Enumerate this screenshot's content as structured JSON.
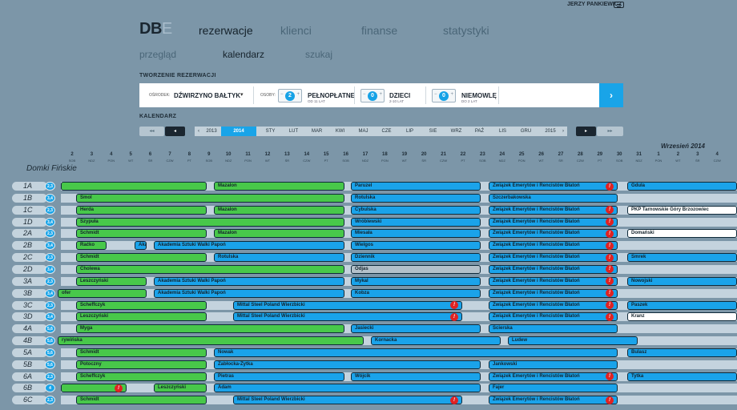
{
  "user": {
    "name": "JERZY PANKIEWICZ"
  },
  "logo": {
    "main": "DB",
    "accent": "E"
  },
  "nav": {
    "main": [
      "rezerwacje",
      "klienci",
      "finanse",
      "statystyki"
    ],
    "sub": [
      "przegląd",
      "kalendarz",
      "szukaj"
    ]
  },
  "sections": {
    "create": "TWORZENIE REZERWACJI",
    "calendar": "KALENDARZ"
  },
  "form": {
    "center_label": "OŚRODEK:",
    "center_value": "DŹWIRZYNO BAŁTYK",
    "persons_label": "OSOBY:",
    "paid": {
      "value": "2",
      "label": "PEŁNOPŁATNE",
      "sub": "OD 11 LAT"
    },
    "kids": {
      "value": "0",
      "label": "DZIECI",
      "sub": "2-10 LAT"
    },
    "infants": {
      "value": "0",
      "label": "NIEMOWLĘ",
      "sub": "DO 2 LAT"
    }
  },
  "timeline": {
    "years": [
      "2013",
      "2014",
      "2015"
    ],
    "months": [
      "STY",
      "LUT",
      "MAR",
      "KWI",
      "MAJ",
      "CZE",
      "LIP",
      "SIE",
      "WRZ",
      "PAŹ",
      "LIS",
      "GRU"
    ],
    "month_title": "Wrzesień  2014"
  },
  "days": [
    [
      "2",
      "SOB"
    ],
    [
      "3",
      "NDZ"
    ],
    [
      "4",
      "PON"
    ],
    [
      "5",
      "WT"
    ],
    [
      "6",
      "ŚR"
    ],
    [
      "7",
      "CZW"
    ],
    [
      "8",
      "PT"
    ],
    [
      "9",
      "SOB"
    ],
    [
      "10",
      "NDZ"
    ],
    [
      "11",
      "PON"
    ],
    [
      "12",
      "WT"
    ],
    [
      "13",
      "ŚR"
    ],
    [
      "14",
      "CZW"
    ],
    [
      "15",
      "PT"
    ],
    [
      "16",
      "SOB"
    ],
    [
      "17",
      "NDZ"
    ],
    [
      "18",
      "PON"
    ],
    [
      "19",
      "WT"
    ],
    [
      "20",
      "ŚR"
    ],
    [
      "21",
      "CZW"
    ],
    [
      "22",
      "PT"
    ],
    [
      "23",
      "SOB"
    ],
    [
      "24",
      "NDZ"
    ],
    [
      "25",
      "PON"
    ],
    [
      "26",
      "WT"
    ],
    [
      "27",
      "ŚR"
    ],
    [
      "28",
      "CZW"
    ],
    [
      "29",
      "PT"
    ],
    [
      "30",
      "SOB"
    ],
    [
      "31",
      "NDZ"
    ],
    [
      "1",
      "PON"
    ],
    [
      "2",
      "WT"
    ],
    [
      "3",
      "ŚR"
    ],
    [
      "4",
      "CZW"
    ]
  ],
  "group": "Domki Fińskie",
  "rows": [
    {
      "id": "1A",
      "cap": "2,3",
      "bars": [
        [
          "g",
          76,
          258,
          ""
        ],
        [
          "g",
          267,
          430,
          "Mazalon"
        ],
        [
          "b",
          438,
          600,
          "Paruzel"
        ],
        [
          "b",
          610,
          771,
          "Związek Emerytów i Rencistów Błatoń",
          "!"
        ],
        [
          "b",
          783,
          920,
          "Gdula"
        ]
      ]
    },
    {
      "id": "1B",
      "cap": "3,4",
      "bars": [
        [
          "g",
          95,
          430,
          "Smol"
        ],
        [
          "b",
          438,
          600,
          "Rotulska"
        ],
        [
          "b",
          610,
          771,
          "Szczerbakowska"
        ]
      ]
    },
    {
      "id": "1C",
      "cap": "2,3",
      "bars": [
        [
          "g",
          95,
          258,
          "Herda"
        ],
        [
          "g",
          267,
          430,
          "Mazalon"
        ],
        [
          "b",
          438,
          600,
          "Cybulska"
        ],
        [
          "b",
          610,
          771,
          "Związek Emerytów i Rencistów Błatoń",
          "!"
        ],
        [
          "w",
          783,
          920,
          "PKP Tarnowskie Góry Brzozowiec"
        ]
      ]
    },
    {
      "id": "1D",
      "cap": "3,4",
      "bars": [
        [
          "g",
          95,
          430,
          "Szypuła"
        ],
        [
          "b",
          438,
          600,
          "Wróblewski"
        ],
        [
          "b",
          610,
          771,
          "Związek Emerytów i Rencistów Błatoń",
          "!"
        ]
      ]
    },
    {
      "id": "2A",
      "cap": "2,3",
      "bars": [
        [
          "g",
          95,
          258,
          "Schmidt"
        ],
        [
          "g",
          267,
          430,
          "Mazalon"
        ],
        [
          "b",
          438,
          600,
          "Miesała"
        ],
        [
          "b",
          610,
          771,
          "Związek Emerytów i Rencistów Błatoń",
          "!"
        ],
        [
          "w",
          783,
          920,
          "Domański"
        ]
      ]
    },
    {
      "id": "2B",
      "cap": "3,4",
      "bars": [
        [
          "g",
          95,
          133,
          "Raćko"
        ],
        [
          "b",
          168,
          183,
          "Aka"
        ],
        [
          "b",
          192,
          430,
          "Akademia Sztuki Walki Papoń"
        ],
        [
          "b",
          438,
          600,
          "Wielgos"
        ],
        [
          "b",
          610,
          771,
          "Związek Emerytów i Rencistów Błatoń",
          "!"
        ]
      ]
    },
    {
      "id": "2C",
      "cap": "2,3",
      "bars": [
        [
          "g",
          95,
          258,
          "Schmidt"
        ],
        [
          "b",
          267,
          430,
          "Rotulska"
        ],
        [
          "b",
          438,
          600,
          "Dziennik"
        ],
        [
          "b",
          610,
          771,
          "Związek Emerytów i Rencistów Błatoń",
          "!"
        ],
        [
          "b",
          783,
          920,
          "Smrek"
        ]
      ]
    },
    {
      "id": "2D",
      "cap": "3,4",
      "bars": [
        [
          "g",
          95,
          430,
          "Cholewa"
        ],
        [
          "gr",
          438,
          600,
          "Odjas"
        ],
        [
          "b",
          610,
          771,
          "Związek Emerytów i Rencistów Błatoń",
          "!"
        ]
      ]
    },
    {
      "id": "3A",
      "cap": "2,3",
      "bars": [
        [
          "g",
          95,
          183,
          "Leszczyński"
        ],
        [
          "b",
          192,
          430,
          "Akademia Sztuki Walki Papoń"
        ],
        [
          "b",
          438,
          600,
          "Mykal"
        ],
        [
          "b",
          610,
          771,
          "Związek Emerytów i Rencistów Błatoń",
          "!"
        ],
        [
          "b",
          783,
          920,
          "Nowojski"
        ]
      ]
    },
    {
      "id": "3B",
      "cap": "3,4",
      "bars": [
        [
          "g",
          72,
          183,
          "ofer"
        ],
        [
          "b",
          192,
          430,
          "Akademia Sztuki Walki Papoń"
        ],
        [
          "b",
          438,
          600,
          "Kobza"
        ],
        [
          "b",
          610,
          771,
          "Związek Emerytów i Rencistów Błatoń",
          "!"
        ]
      ]
    },
    {
      "id": "3C",
      "cap": "2,3",
      "bars": [
        [
          "g",
          95,
          258,
          "Scheffczyk"
        ],
        [
          "b",
          291,
          577,
          "Mittal Steel Poland Wierzbicki",
          "!"
        ],
        [
          "b",
          610,
          771,
          "Związek Emerytów i Rencistów Błatoń",
          "!"
        ],
        [
          "b",
          783,
          920,
          "Paszek"
        ]
      ]
    },
    {
      "id": "3D",
      "cap": "3,4",
      "bars": [
        [
          "g",
          95,
          258,
          "Leszczyński"
        ],
        [
          "b",
          291,
          577,
          "Mittal Steel Poland Wierzbicki",
          "!"
        ],
        [
          "b",
          610,
          771,
          "Związek Emerytów i Rencistów Błatoń",
          "!"
        ],
        [
          "w",
          783,
          920,
          "Kranz"
        ]
      ]
    },
    {
      "id": "4A",
      "cap": "5,6",
      "bars": [
        [
          "g",
          95,
          430,
          "Myga"
        ],
        [
          "b",
          438,
          600,
          "Jasiecki"
        ],
        [
          "b",
          610,
          771,
          "Ścierska"
        ]
      ]
    },
    {
      "id": "4B",
      "cap": "5,6",
      "bars": [
        [
          "g",
          72,
          454,
          "rywińska"
        ],
        [
          "b",
          463,
          625,
          "Kornacka"
        ],
        [
          "b",
          634,
          796,
          "Ludew"
        ]
      ]
    },
    {
      "id": "5A",
      "cap": "5,6",
      "bars": [
        [
          "g",
          95,
          258,
          "Schmidt"
        ],
        [
          "b",
          267,
          771,
          "Nowak"
        ],
        [
          "b",
          783,
          920,
          "Bulasz"
        ]
      ]
    },
    {
      "id": "5B",
      "cap": "5,6",
      "bars": [
        [
          "g",
          95,
          258,
          "Potoczny"
        ],
        [
          "b",
          267,
          600,
          "Zabłocka-Żytka"
        ],
        [
          "b",
          610,
          771,
          "Jankowski"
        ]
      ]
    },
    {
      "id": "6A",
      "cap": "2,3",
      "bars": [
        [
          "g",
          95,
          258,
          "Scheffczyk"
        ],
        [
          "b",
          267,
          430,
          "Pietras"
        ],
        [
          "b",
          438,
          600,
          "Wójcik"
        ],
        [
          "b",
          610,
          771,
          "Związek Emerytów i Rencistów Błatoń",
          "!"
        ],
        [
          "b",
          783,
          920,
          "Tytka"
        ]
      ]
    },
    {
      "id": "6B",
      "cap": "4",
      "bars": [
        [
          "g",
          76,
          158,
          "",
          "!"
        ],
        [
          "g",
          192,
          258,
          "Leszczyński"
        ],
        [
          "b",
          267,
          600,
          "Adam"
        ],
        [
          "b",
          610,
          771,
          "Fajer"
        ]
      ]
    },
    {
      "id": "6C",
      "cap": "2,3",
      "bars": [
        [
          "g",
          95,
          258,
          "Schmidt"
        ],
        [
          "b",
          291,
          577,
          "Mittal Steel Poland Wierzbicki",
          "!"
        ],
        [
          "b",
          610,
          771,
          "Związek Emerytów i Rencistów Błatoń",
          "!"
        ]
      ]
    }
  ]
}
